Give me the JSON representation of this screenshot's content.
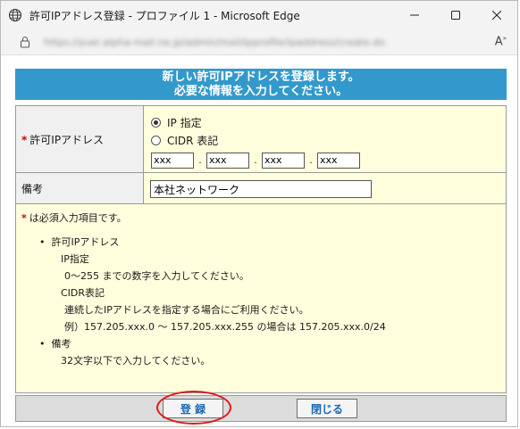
{
  "window": {
    "title": "許可IPアドレス登録 - プロファイル 1 - Microsoft Edge",
    "url": "https://yuei.alpha-mail.ne.jp/admin/mail/ipprofile/ipaddress/create.do",
    "controls": [
      "minimize",
      "maximize",
      "close"
    ]
  },
  "header": {
    "line1": "新しい許可IPアドレスを登録します。",
    "line2": "必要な情報を入力してください。"
  },
  "form": {
    "ip": {
      "label": "許可IPアドレス",
      "required_mark": "*",
      "radio_ip_label": "IP 指定",
      "radio_cidr_label": "CIDR 表記",
      "selected": "ip",
      "octets": [
        "xxx",
        "xxx",
        "xxx",
        "xxx"
      ],
      "dot": "."
    },
    "memo": {
      "label": "備考",
      "value": "本社ネットワーク"
    }
  },
  "notes": {
    "required_mark": "*",
    "required_text": "は必須入力項目です。",
    "bullet1": "許可IPアドレス",
    "ip_title": "IP指定",
    "ip_desc": "0～255 までの数字を入力してください。",
    "cidr_title": "CIDR表記",
    "cidr_desc": "連続したIPアドレスを指定する場合にご利用ください。",
    "cidr_example": "例）157.205.xxx.0 ～ 157.205.xxx.255 の場合は 157.205.xxx.0/24",
    "bullet2": "備考",
    "memo_desc": "32文字以下で入力してください。"
  },
  "buttons": {
    "register": "登 録",
    "close": "閉じる"
  },
  "colors": {
    "header_bg": "#3399cc",
    "field_bg": "#ffffdd",
    "required": "#cc0000",
    "annotation": "#e01818"
  }
}
